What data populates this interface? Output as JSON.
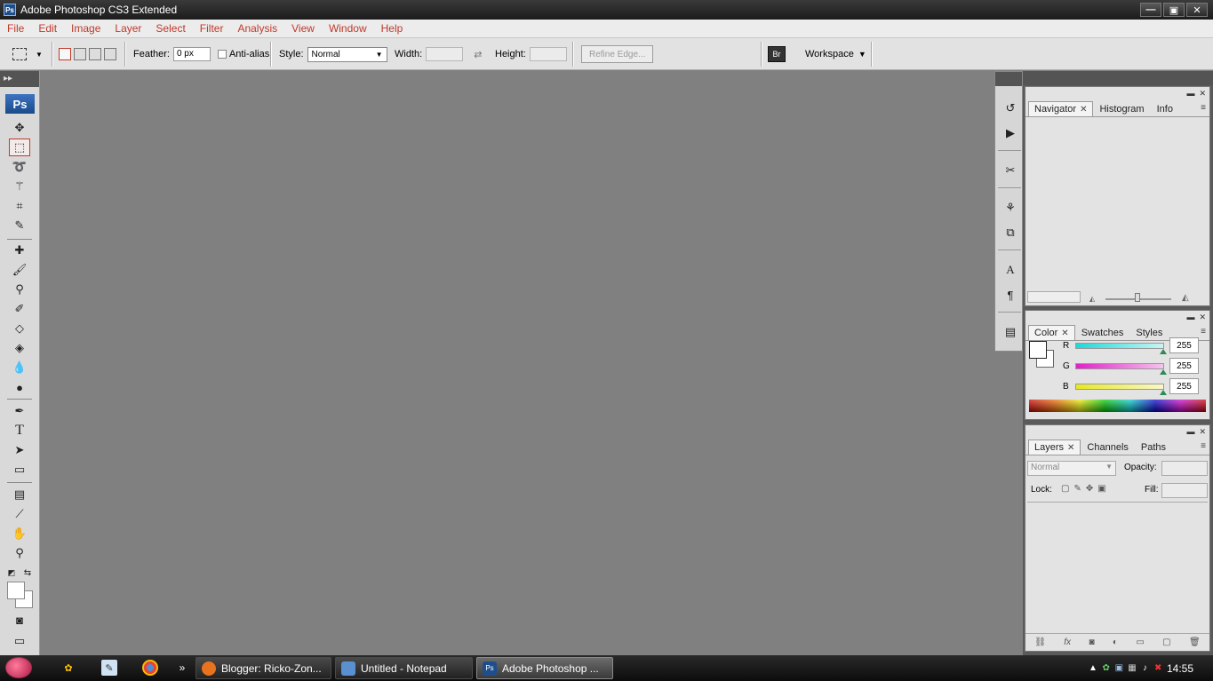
{
  "window": {
    "title": "Adobe Photoshop CS3 Extended",
    "app_badge": "Ps",
    "buttons": {
      "minimize": "—",
      "restore": "▣",
      "close": "✕"
    }
  },
  "menu": [
    "File",
    "Edit",
    "Image",
    "Layer",
    "Select",
    "Filter",
    "Analysis",
    "View",
    "Window",
    "Help"
  ],
  "options": {
    "feather_label": "Feather:",
    "feather_value": "0 px",
    "antialias_label": "Anti-alias",
    "style_label": "Style:",
    "style_value": "Normal",
    "width_label": "Width:",
    "height_label": "Height:",
    "refine_label": "Refine Edge...",
    "workspace_label": "Workspace"
  },
  "toolbox": {
    "logo": "Ps"
  },
  "navigator_panel": {
    "tabs": [
      "Navigator",
      "Histogram",
      "Info"
    ]
  },
  "color_panel": {
    "tabs": [
      "Color",
      "Swatches",
      "Styles"
    ],
    "channels": [
      {
        "label": "R",
        "value": "255",
        "color": "#1fd8d8"
      },
      {
        "label": "G",
        "value": "255",
        "color": "#e020c8"
      },
      {
        "label": "B",
        "value": "255",
        "color": "#e8e820"
      }
    ]
  },
  "layers_panel": {
    "tabs": [
      "Layers",
      "Channels",
      "Paths"
    ],
    "blend_mode": "Normal",
    "opacity_label": "Opacity:",
    "lock_label": "Lock:",
    "fill_label": "Fill:"
  },
  "taskbar": {
    "tasks": [
      {
        "label": "Blogger: Ricko-Zon...",
        "icon_color": "#e8731f"
      },
      {
        "label": "Untitled - Notepad",
        "icon_color": "#5a8fd0"
      },
      {
        "label": "Adobe Photoshop ...",
        "icon_color": "#1e4f8c"
      }
    ],
    "clock": "14:55"
  }
}
